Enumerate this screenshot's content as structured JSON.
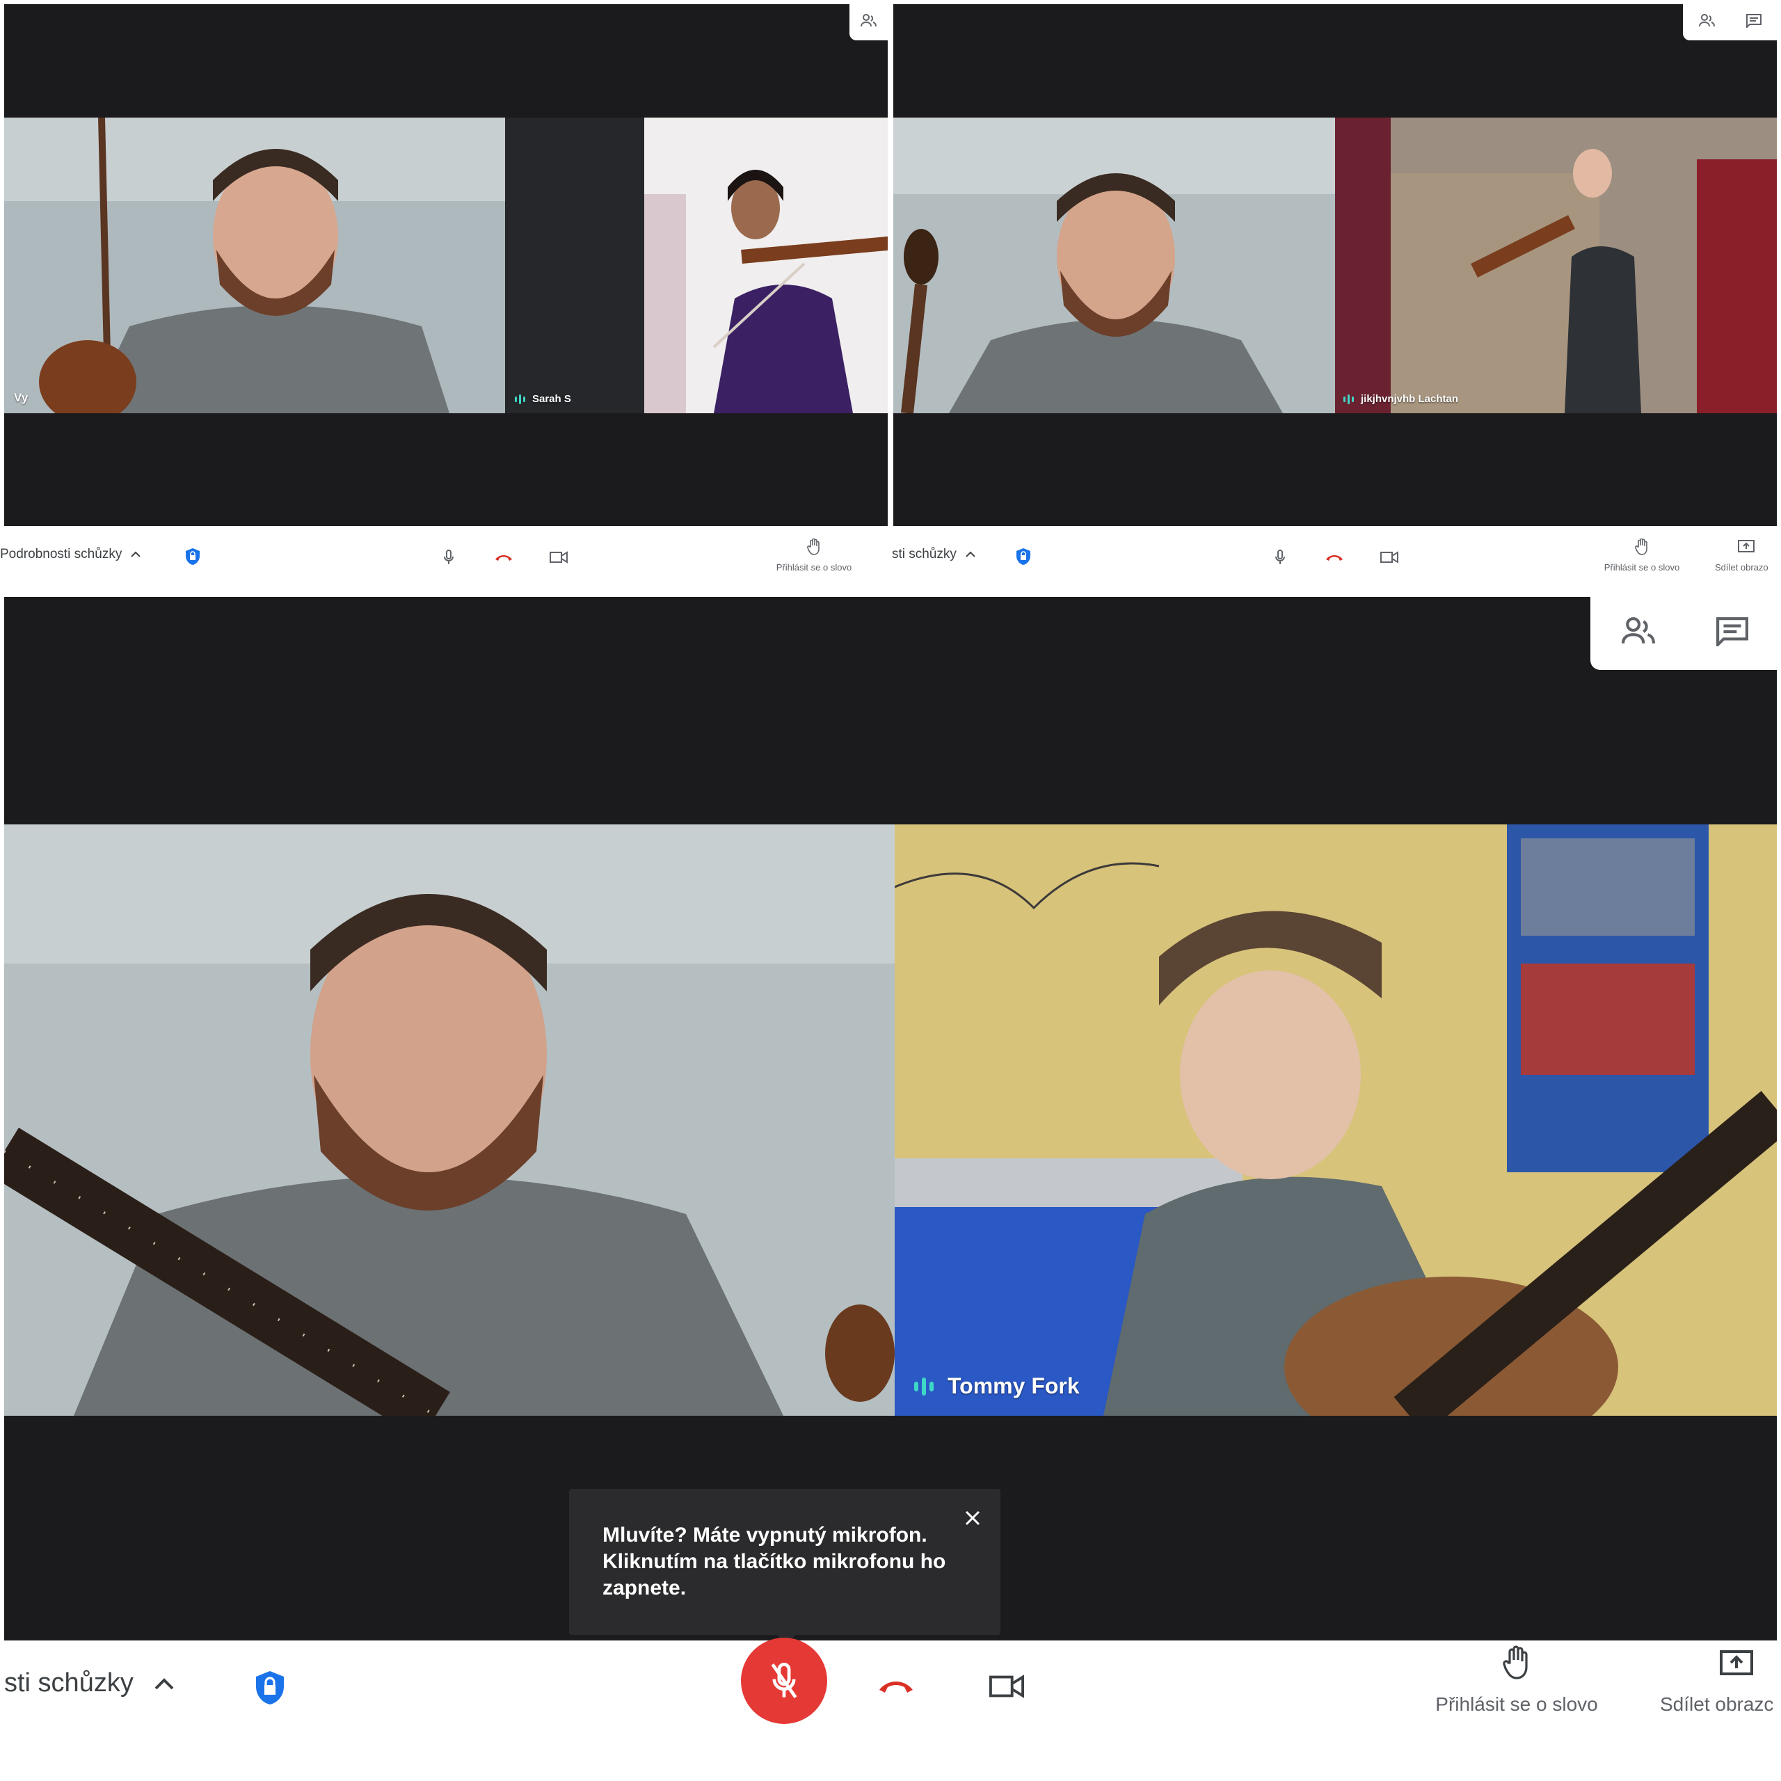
{
  "panels": [
    {
      "tiles": [
        {
          "name": "Vy",
          "speaking": false
        },
        {
          "name": "Sarah S",
          "speaking": true
        }
      ],
      "toolbar": {
        "details_label": "Podrobnosti schůzky",
        "raise_hand_label": "Přihlásit se o slovo"
      },
      "people_count": "2"
    },
    {
      "tiles": [
        {
          "name": "",
          "speaking": false
        },
        {
          "name": "jikjhvnjvhb Lachtan",
          "speaking": true
        }
      ],
      "toolbar": {
        "details_label": "sti schůzky",
        "raise_hand_label": "Přihlásit se o slovo",
        "share_label": "Sdílet obrazo"
      },
      "people_count": "2"
    },
    {
      "tiles": [
        {
          "name": "",
          "speaking": false
        },
        {
          "name": "Tommy Fork",
          "speaking": true
        }
      ],
      "toolbar": {
        "details_label": "sti schůzky",
        "raise_hand_label": "Přihlásit se o slovo",
        "share_label": "Sdílet obrazc"
      },
      "people_count": "2",
      "toast": {
        "line1": "Mluvíte? Máte vypnutý mikrofon.",
        "line2": "Kliknutím na tlačítko mikrofonu ho",
        "line3": "zapnete."
      }
    }
  ],
  "colors": {
    "stage_bg": "#1b1b1d",
    "hangup_red": "#d93025",
    "shield_blue": "#1a73e8",
    "speaking_teal": "#3fd7c6"
  }
}
